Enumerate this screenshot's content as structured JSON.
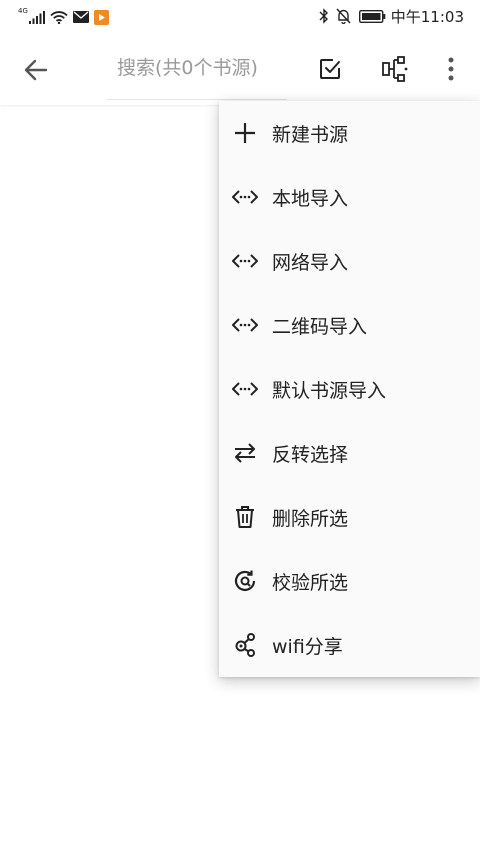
{
  "status_bar": {
    "network": "4G",
    "time": "中午11:03",
    "icons": [
      "signal-icon",
      "wifi-icon",
      "mail-icon",
      "app-notification-icon",
      "bluetooth-icon",
      "mute-icon",
      "battery-icon"
    ]
  },
  "app_bar": {
    "back_icon": "arrow-back-icon",
    "search": {
      "placeholder": "搜索(共0个书源)",
      "value": ""
    },
    "actions": [
      "select-all-icon",
      "group-icon",
      "more-vert-icon"
    ]
  },
  "overflow_menu": {
    "items": [
      {
        "label": "新建书源",
        "icon": "add-icon"
      },
      {
        "label": "本地导入",
        "icon": "import-icon"
      },
      {
        "label": "网络导入",
        "icon": "import-icon"
      },
      {
        "label": "二维码导入",
        "icon": "import-icon"
      },
      {
        "label": "默认书源导入",
        "icon": "import-icon"
      },
      {
        "label": "反转选择",
        "icon": "swap-icon"
      },
      {
        "label": "删除所选",
        "icon": "trash-icon"
      },
      {
        "label": "校验所选",
        "icon": "check-verify-icon"
      },
      {
        "label": "wifi分享",
        "icon": "share-icon"
      }
    ]
  },
  "colors": {
    "background": "#ffffff",
    "menu_background": "#fafafa",
    "text_primary": "#222222",
    "placeholder": "#9a9a9a",
    "notification_badge": "#f08a24"
  }
}
